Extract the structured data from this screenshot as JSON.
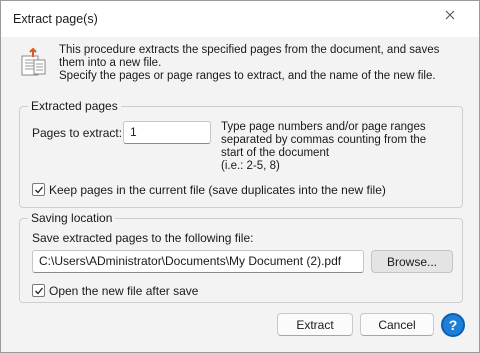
{
  "window": {
    "title": "Extract page(s)"
  },
  "intro": {
    "line1": "This procedure extracts the specified pages from the document, and saves them into a new file.",
    "line2": "Specify the pages or page ranges to extract, and the name of the new file."
  },
  "extracted": {
    "legend": "Extracted pages",
    "pages_label": "Pages to extract:",
    "pages_value": "1",
    "hint": "Type page numbers and/or page ranges separated by commas counting from the start of the document",
    "hint_example": "(i.e.: 2-5, 8)",
    "keep_label": "Keep pages in the current file (save duplicates into the new file)",
    "keep_checked": true
  },
  "saving": {
    "legend": "Saving location",
    "file_label": "Save extracted pages to the following file:",
    "file_value": "C:\\Users\\ADministrator\\Documents\\My Document (2).pdf",
    "browse_label": "Browse...",
    "open_label": "Open the new file after save",
    "open_checked": true
  },
  "buttons": {
    "extract": "Extract",
    "cancel": "Cancel",
    "help": "?"
  },
  "icons": [
    "close-icon",
    "document-extract-icon",
    "checkmark-icon",
    "help-icon"
  ],
  "colors": {
    "accent": "#1e7fd8"
  }
}
